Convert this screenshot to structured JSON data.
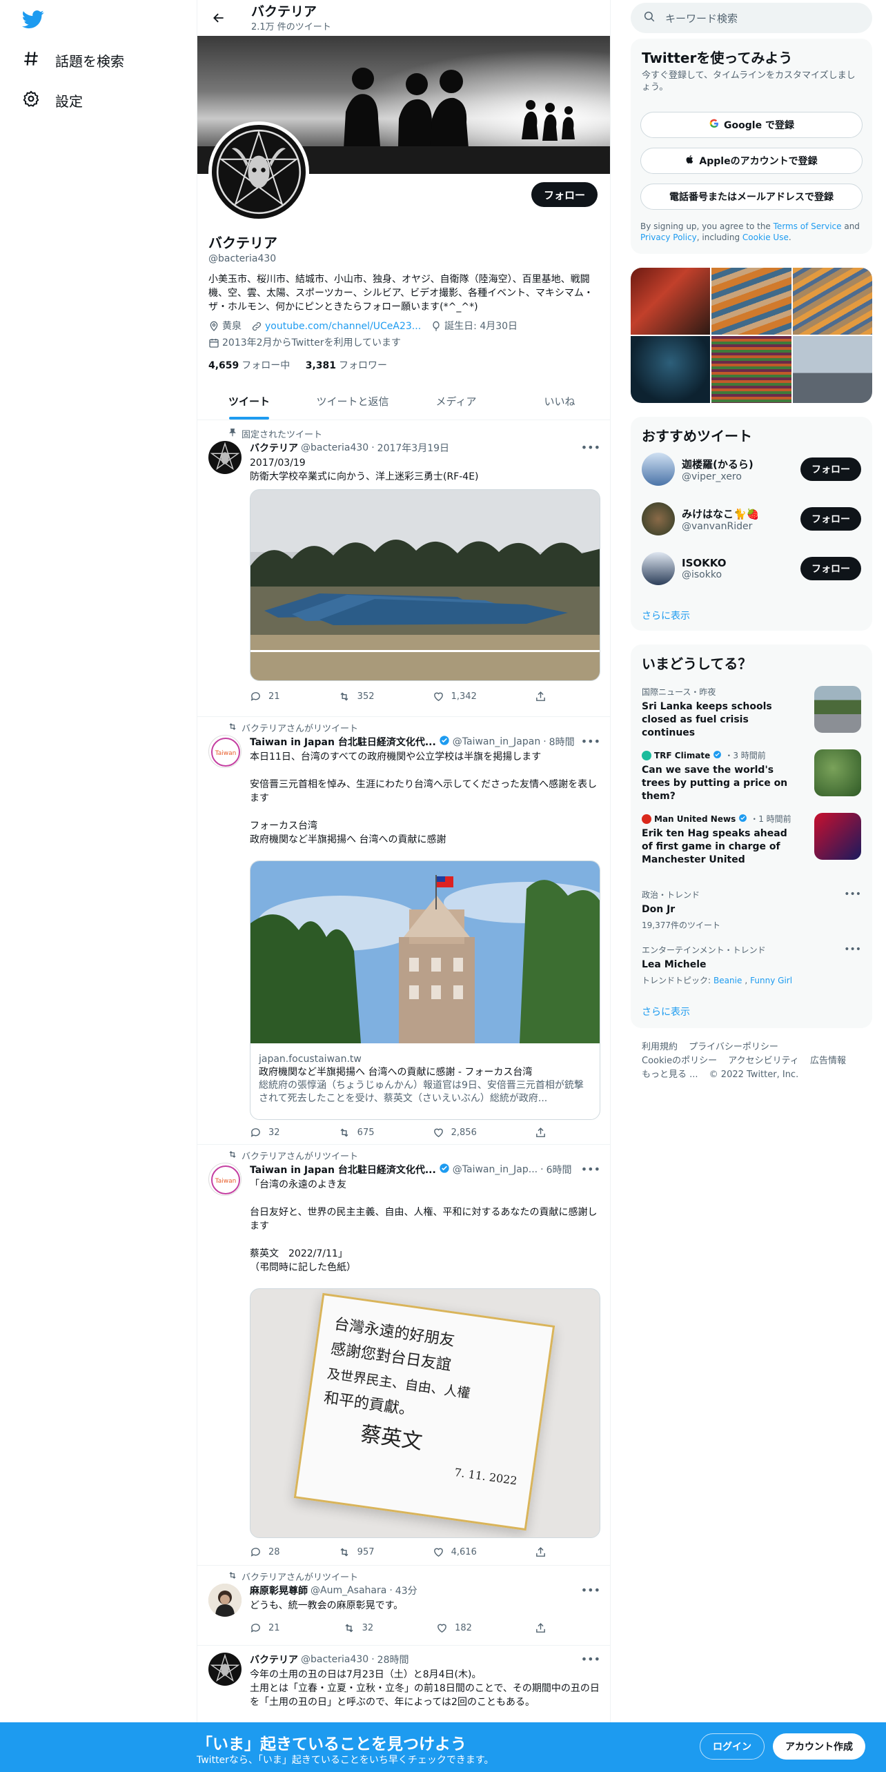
{
  "nav": {
    "explore": "話題を検索",
    "settings": "設定",
    "logo_icon": "twitter-bird-icon"
  },
  "header": {
    "name": "バクテリア",
    "tweet_count": "2.1万 件のツイート"
  },
  "profile": {
    "name": "バクテリア",
    "handle": "@bacteria430",
    "follow_label": "フォロー",
    "bio": "小美玉市、桜川市、結城市、小山市、独身、オヤジ、自衛隊（陸海空）、百里基地、戦闘機、空、雲、太陽、スポーツカー、シルビア、ビデオ撮影、各種イベント、マキシマム・ザ・ホルモン、何かにピンときたらフォロー願います(*^_^*)",
    "location": "黄泉",
    "url": "youtube.com/channel/UCeA23...",
    "birthday": "誕生日: 4月30日",
    "joined": "2013年2月からTwitterを利用しています",
    "following_count": "4,659",
    "following_label": "フォロー中",
    "followers_count": "3,381",
    "followers_label": "フォロワー"
  },
  "tabs": [
    "ツイート",
    "ツイートと返信",
    "メディア",
    "いいね"
  ],
  "tweets": [
    {
      "label": "固定されたツイート",
      "name": "バクテリア",
      "handle": "@bacteria430",
      "time": "2017年3月19日",
      "text": "2017/03/19\n防衛大学校卒業式に向かう、洋上迷彩三勇士(RF-4E)",
      "reply": "21",
      "retweet": "352",
      "like": "1,342"
    },
    {
      "label": "バクテリアさんがリツイート",
      "name": "Taiwan in Japan 台北駐日経済文化代...",
      "handle": "@Taiwan_in_Japan",
      "time": "8時間",
      "text": "本日11日、台湾のすべての政府機関や公立学校は半旗を掲揚します\n\n安倍晋三元首相を悼み、生涯にわたり台湾へ示してくださった友情へ感謝を表します\n\nフォーカス台湾\n政府機関など半旗掲揚へ 台湾への貢献に感謝",
      "card_domain": "japan.focustaiwan.tw",
      "card_title": "政府機関など半旗掲揚へ 台湾への貢献に感謝 - フォーカス台湾",
      "card_desc": "総統府の張惇涵（ちょうじゅんかん）報道官は9日、安倍晋三元首相が銃撃されて死去したことを受け、蔡英文（さいえいぶん）総統が政府...",
      "reply": "32",
      "retweet": "675",
      "like": "2,856"
    },
    {
      "label": "バクテリアさんがリツイート",
      "name": "Taiwan in Japan 台北駐日経済文化代...",
      "handle": "@Taiwan_in_Jap...",
      "time": "6時間",
      "text": "「台湾の永遠のよき友\n\n台日友好と、世界の民主主義、自由、人権、平和に対するあなたの貢献に感謝します\n\n蔡英文　2022/7/11」\n（弔問時に記した色紙）",
      "shikishi_lines": [
        "台灣永遠的好朋友",
        "感謝您對台日友誼",
        "及世界民主、自由、人權",
        "和平的貢獻。",
        "蔡英文",
        "7. 11. 2022"
      ],
      "reply": "28",
      "retweet": "957",
      "like": "4,616"
    },
    {
      "label": "バクテリアさんがリツイート",
      "name": "麻原彰晃尊師",
      "handle": "@Aum_Asahara",
      "time": "43分",
      "text": "どうも、統一教会の麻原彰晃です。",
      "reply": "21",
      "retweet": "32",
      "like": "182"
    },
    {
      "name": "バクテリア",
      "handle": "@bacteria430",
      "time": "28時間",
      "text": "今年の土用の丑の日は7月23日（土）と8月4日(木)。\n土用とは「立春・立夏・立秋・立冬」の前18日間のことで、その期間中の丑の日を「土用の丑の日」と呼ぶので、年によっては2回のこともある。"
    }
  ],
  "right": {
    "search_placeholder": "キーワード検索",
    "signup": {
      "title": "Twitterを使ってみよう",
      "sub": "今すぐ登録して、タイムラインをカスタマイズしましょう。",
      "google": "Google で登録",
      "apple": "Appleのアカウントで登録",
      "phone": "電話番号またはメールアドレスで登録",
      "terms_pre": "By signing up, you agree to the ",
      "tos": "Terms of Service",
      "and": " and ",
      "privacy": "Privacy Policy",
      "including": ", including ",
      "cookie": "Cookie Use",
      "dot": "."
    },
    "recommend": {
      "title": "おすすめツイート",
      "users": [
        {
          "name": "迦楼羅(かるら)",
          "handle": "@viper_xero"
        },
        {
          "name": "みけはなこ🐈🍓",
          "handle": "@vanvanRider"
        },
        {
          "name": "ISOKKO",
          "handle": "@isokko"
        }
      ],
      "follow": "フォロー",
      "more": "さらに表示"
    },
    "trends": {
      "title": "いまどうしてる？",
      "items": [
        {
          "meta": "国際ニュース・昨夜",
          "title": "Sri Lanka keeps schools closed as fuel crisis continues"
        },
        {
          "meta_name": "TRF Climate",
          "meta_time": "・3 時間前",
          "title": "Can we save the world's trees by putting a price on them?"
        },
        {
          "meta_name": "Man United News",
          "meta_time": "・1 時間前",
          "title": "Erik ten Hag speaks ahead of first game in charge of Manchester United"
        },
        {
          "meta": "政治・トレンド",
          "title": "Don Jr",
          "sub": "19,377件のツイート"
        },
        {
          "meta": "エンターテインメント・トレンド",
          "title": "Lea Michele",
          "sub_pre": "トレンドトピック: ",
          "sub_link1": "Beanie",
          "sub_link2": "Funny Girl"
        }
      ],
      "more": "さらに表示"
    },
    "footer": [
      "利用規約",
      "プライバシーポリシー",
      "Cookieのポリシー",
      "アクセシビリティ",
      "広告情報",
      "もっと見る ...",
      "© 2022 Twitter, Inc."
    ]
  },
  "bottom": {
    "title": "「いま」起きていることを見つけよう",
    "sub": "Twitterなら、「いま」起きていることをいち早くチェックできます。",
    "login": "ログイン",
    "signup": "アカウント作成"
  },
  "colors": {
    "accent": "#1d9bf0",
    "dark": "#0f1419",
    "muted": "#536471"
  }
}
